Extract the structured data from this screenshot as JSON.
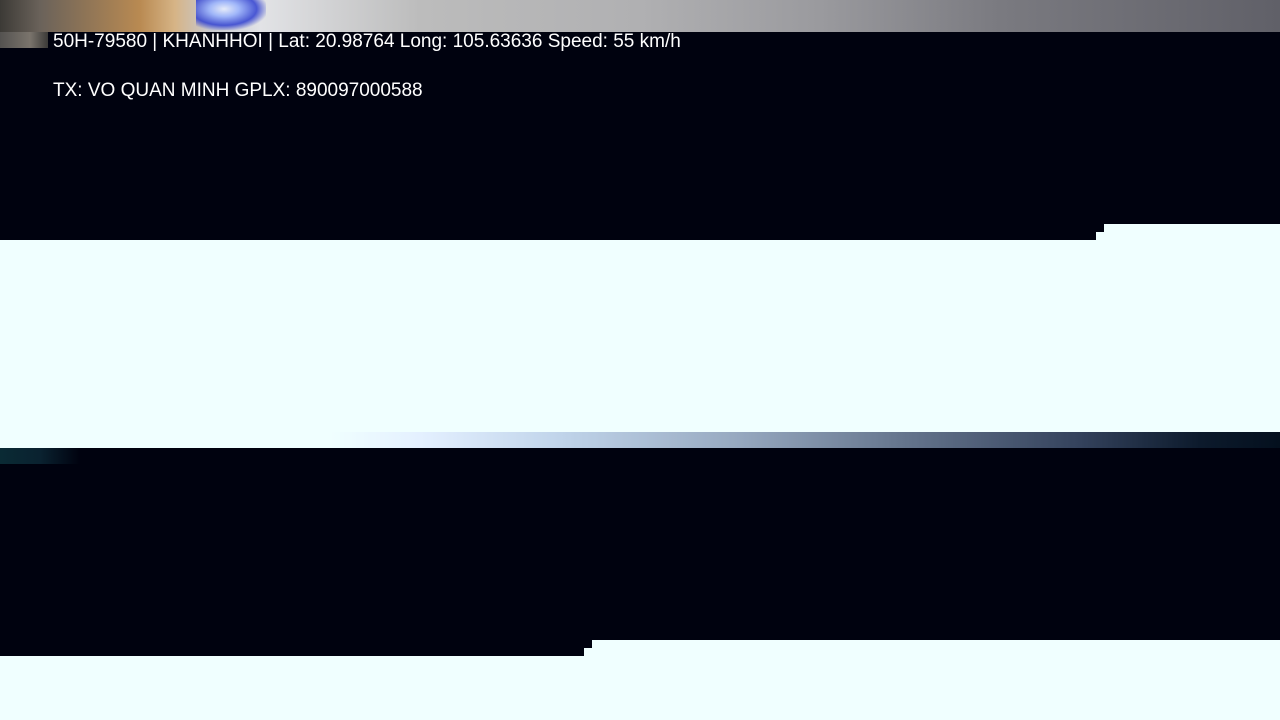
{
  "osd": {
    "line1": "50H-79580 | KHANHHOI | Lat: 20.98764 Long: 105.63636 Speed: 55 km/h",
    "line2": "TX: VO QUAN MINH GPLX: 890097000588"
  },
  "colors": {
    "background": "#00020f",
    "glitch_band": "#f0ffff",
    "text": "#ffffff"
  }
}
